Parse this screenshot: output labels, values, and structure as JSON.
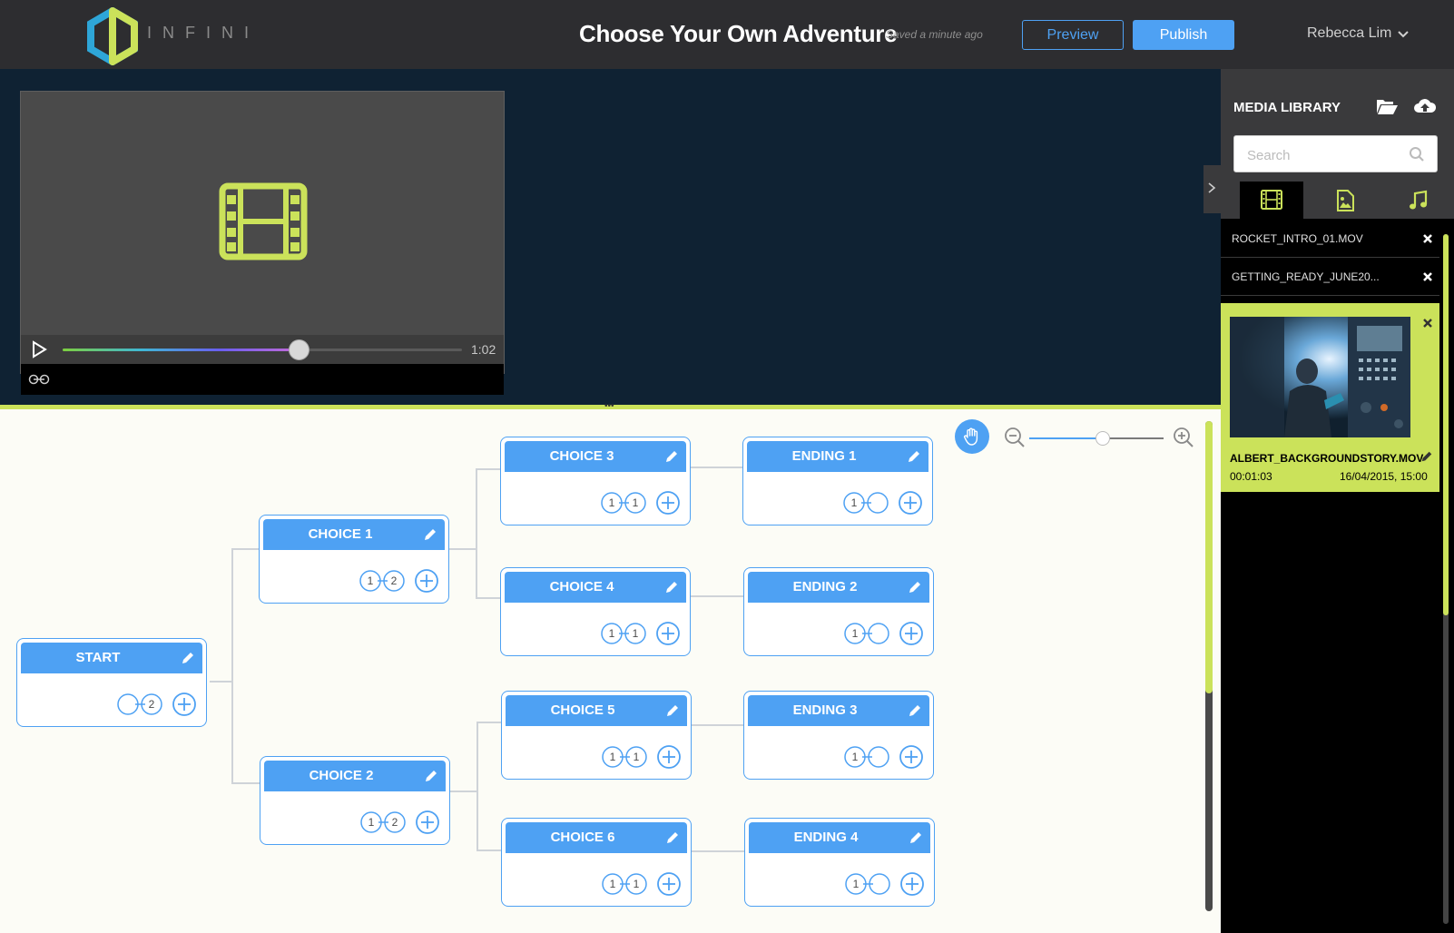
{
  "header": {
    "logo_text": "INFINI",
    "title": "Choose Your Own Adventure",
    "saved_status": "Saved a minute ago",
    "preview_label": "Preview",
    "publish_label": "Publish",
    "user_name": "Rebecca Lim"
  },
  "player": {
    "duration": "1:02",
    "progress": 0.59
  },
  "colors": {
    "accent_blue": "#4ea1f3",
    "accent_green": "#cbe25a",
    "header_bg": "#2d2d30",
    "editor_bg": "#0f2233"
  },
  "zoom": {
    "level": 0.55
  },
  "nodes": [
    {
      "id": "start",
      "title": "START",
      "conn_left": "",
      "conn_right": "2"
    },
    {
      "id": "choice1",
      "title": "CHOICE 1",
      "conn_left": "1",
      "conn_right": "2"
    },
    {
      "id": "choice2",
      "title": "CHOICE 2",
      "conn_left": "1",
      "conn_right": "2"
    },
    {
      "id": "choice3",
      "title": "CHOICE 3",
      "conn_left": "1",
      "conn_right": "1"
    },
    {
      "id": "choice4",
      "title": "CHOICE 4",
      "conn_left": "1",
      "conn_right": "1"
    },
    {
      "id": "choice5",
      "title": "CHOICE 5",
      "conn_left": "1",
      "conn_right": "1"
    },
    {
      "id": "choice6",
      "title": "CHOICE 6",
      "conn_left": "1",
      "conn_right": "1"
    },
    {
      "id": "ending1",
      "title": "ENDING 1",
      "conn_left": "1",
      "conn_right": ""
    },
    {
      "id": "ending2",
      "title": "ENDING 2",
      "conn_left": "1",
      "conn_right": ""
    },
    {
      "id": "ending3",
      "title": "ENDING 3",
      "conn_left": "1",
      "conn_right": ""
    },
    {
      "id": "ending4",
      "title": "ENDING 4",
      "conn_left": "1",
      "conn_right": ""
    }
  ],
  "media_library": {
    "title": "MEDIA LIBRARY",
    "search_placeholder": "Search",
    "tabs": [
      "video-tab",
      "image-tab",
      "music-tab"
    ],
    "items": [
      {
        "name": "ROCKET_INTRO_01.MOV"
      },
      {
        "name": "GETTING_READY_JUNE20..."
      }
    ],
    "selected": {
      "name": "ALBERT_BACKGROUNDSTORY.MOV",
      "duration": "00:01:03",
      "date": "16/04/2015, 15:00"
    }
  }
}
